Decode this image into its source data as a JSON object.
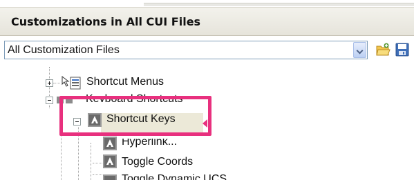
{
  "panel": {
    "title": "Customizations in All CUI Files"
  },
  "filter": {
    "selected": "All Customization Files"
  },
  "toolbar": {
    "icons": [
      "open-cui-file-icon",
      "save-icon"
    ]
  },
  "tree": {
    "nodes": [
      {
        "label": "Shortcut Menus",
        "expanded": false,
        "icon": "shortcut-menus-icon"
      },
      {
        "label": "Keyboard Shortcuts",
        "expanded": true,
        "icon": "keyboard-shortcuts-icon"
      },
      {
        "label": "Shortcut Keys",
        "expanded": true,
        "icon": "shortcut-keys-icon",
        "selected": true
      },
      {
        "label": "Hyperlink...",
        "icon": "command-icon"
      },
      {
        "label": "Toggle Coords",
        "icon": "command-icon"
      },
      {
        "label": "Toggle Dynamic UCS",
        "icon": "command-icon"
      }
    ]
  },
  "colors": {
    "highlight_box": "#e8307e",
    "header_bg": "#e6e4db",
    "selected_bg": "#ece9d8"
  }
}
